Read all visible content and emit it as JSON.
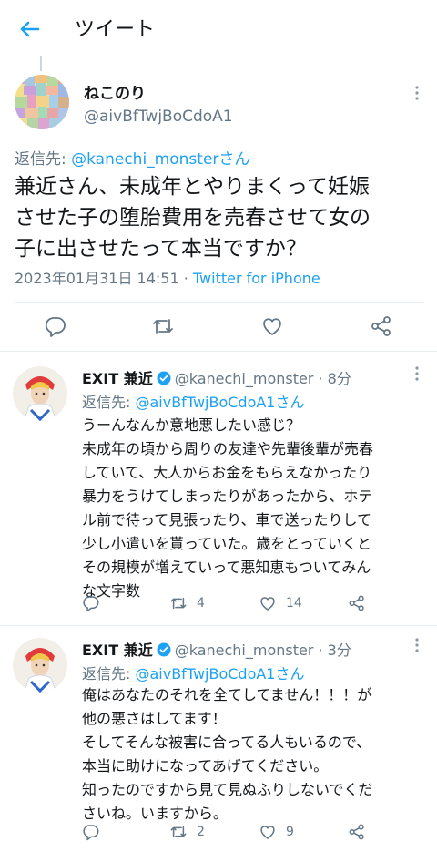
{
  "header": {
    "title": "ツイート"
  },
  "main_tweet": {
    "name": "ねこのり",
    "handle": "@aivBfTwjBoCdoA1",
    "reply_prefix": "返信先: ",
    "reply_to": "@kanechi_monsterさん",
    "text_lines": [
      "兼近さん、未成年とやりまくって妊娠",
      "させた子の堕胎費用を売春させて女の",
      "子に出させたって本当ですか？"
    ],
    "date": "2023年01月31日 14:51",
    "separator": " · ",
    "source": "Twitter for iPhone"
  },
  "replies": [
    {
      "name": "EXIT 兼近",
      "handle": "@kanechi_monster",
      "time": " · 8分",
      "reply_prefix": "返信先: ",
      "reply_to": "@aivBfTwjBoCdoA1さん",
      "text": "うーんなんか意地悪したい感じ？\n未成年の頃から周りの友達や先輩後輩が売春\nしていて、大人からお金をもらえなかったり\n暴力をうけてしまったりがあったから、ホテ\nル前で待って見張ったり、車で送ったりして\n少し小遣いを貰っていた。歳をとっていくと\nその規模が増えていって悪知恵もついてみん\nな文字数",
      "retweets": "4",
      "likes": "14"
    },
    {
      "name": "EXIT 兼近",
      "handle": "@kanechi_monster",
      "time": " · 3分",
      "reply_prefix": "返信先: ",
      "reply_to": "@aivBfTwjBoCdoA1さん",
      "text": "俺はあなたのそれを全てしてません！！！が\n他の悪さはしてます！\nそしてそんな被害に合ってる人もいるので、\n本当に助けになってあげてください。\n知ったのですから見て見ぬふりしないでくだ\nさいね。いますから。",
      "retweets": "2",
      "likes": "9"
    }
  ],
  "colors": {
    "accent": "#1da1f2",
    "secondary_text": "#657786",
    "divider": "#e6ecf0"
  },
  "icons": [
    "back-arrow-icon",
    "more-icon",
    "reply-icon",
    "retweet-icon",
    "like-icon",
    "share-icon",
    "verified-icon"
  ]
}
